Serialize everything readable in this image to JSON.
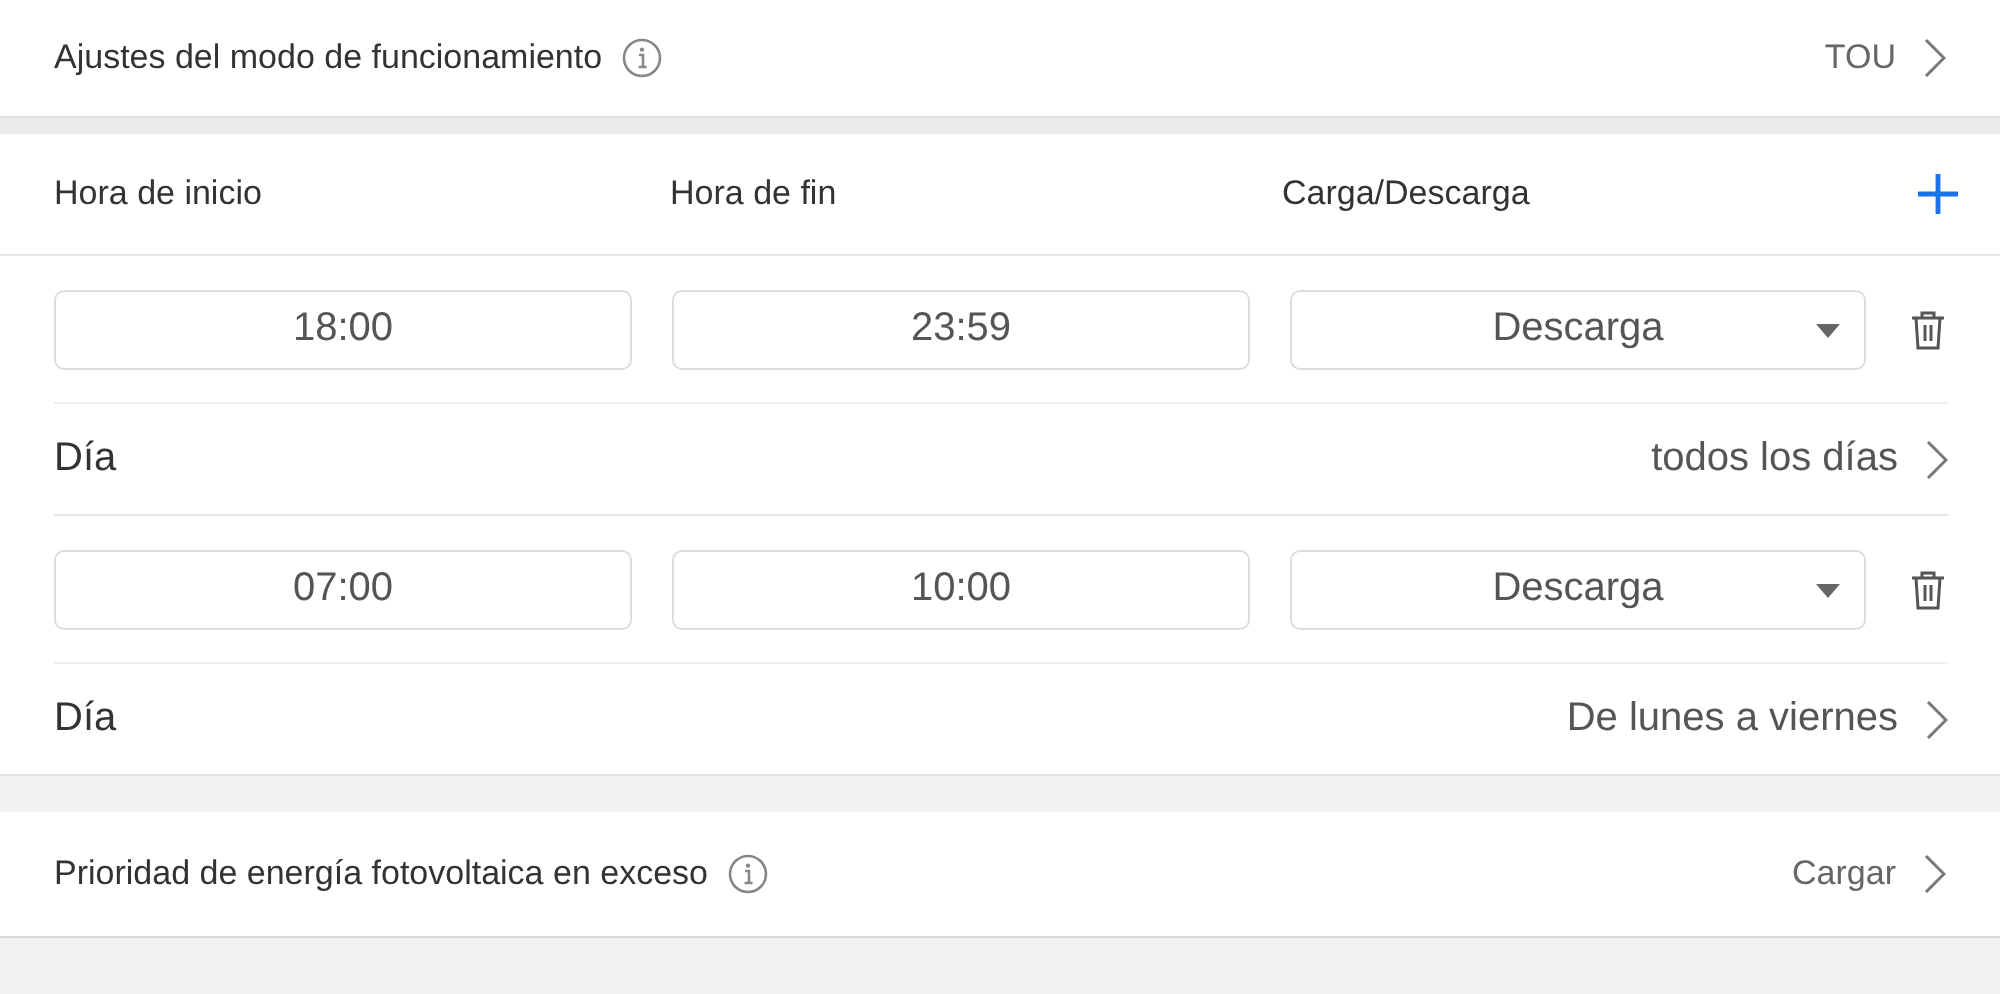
{
  "mode_setting": {
    "label": "Ajustes del modo de funcionamiento",
    "value": "TOU"
  },
  "schedule": {
    "columns": [
      "Hora de inicio",
      "Hora de fin",
      "Carga/Descarga"
    ],
    "slots": [
      {
        "start": "18:00",
        "end": "23:59",
        "action": "Descarga",
        "day_label": "Día",
        "days": "todos los días"
      },
      {
        "start": "07:00",
        "end": "10:00",
        "action": "Descarga",
        "day_label": "Día",
        "days": "De lunes a viernes"
      }
    ]
  },
  "pv_priority": {
    "label": "Prioridad de energía fotovoltaica en exceso",
    "value": "Cargar"
  }
}
